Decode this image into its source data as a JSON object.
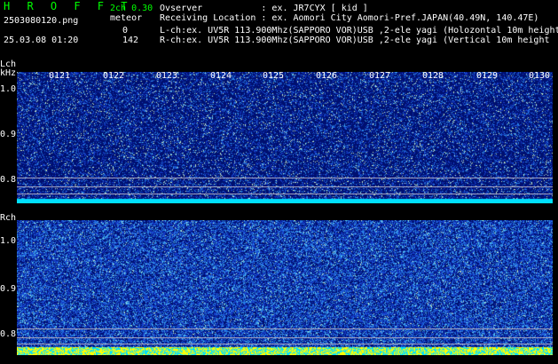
{
  "header": {
    "title": "H R O F F T",
    "filename": "2503080120.png",
    "datetime": "25.03.08 01:20",
    "version": "2ch 0.30",
    "mode": "meteor",
    "count_l": "0",
    "count_r": "142"
  },
  "info": {
    "observer": "Ovserver           : ex. JR7CYX [ kid ]",
    "location": "Receiving Location : ex. Aomori City Aomori-Pref.JAPAN(40.49N, 140.47E)",
    "l_channel": "L-ch:ex. UV5R 113.900Mhz(SAPPORO VOR)USB ,2-ele yagi (Holozontal 10m height",
    "r_channel": "R-ch:ex. UV5R 113.900Mhz(SAPPORO VOR)USB ,2-ele yagi (Vertical 10m height"
  },
  "left_panel": {
    "label": "Lch",
    "unit": "kHz",
    "ticks": [
      "1.0",
      "0.9",
      "0.8"
    ]
  },
  "right_panel": {
    "label": "Rch",
    "ticks": [
      "1.0",
      "0.9",
      "0.8"
    ]
  },
  "time_axis": [
    "0121",
    "0122",
    "0123",
    "0124",
    "0125",
    "0126",
    "0127",
    "0128",
    "0129",
    "0130"
  ],
  "colors": {
    "background": "#000000",
    "title": "#00ff00",
    "spectrogram_bg": "#001070",
    "baseline": "#00e0ff",
    "burst": "#ffff00"
  }
}
